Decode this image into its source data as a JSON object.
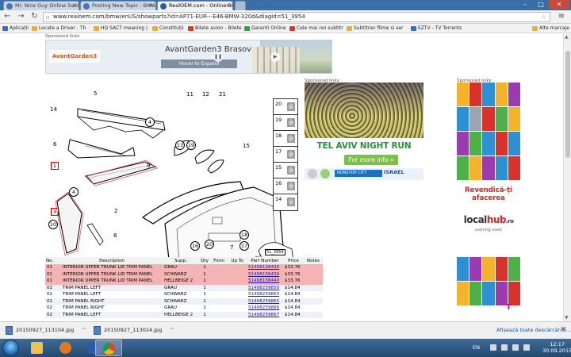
{
  "browser": {
    "tabs": [
      {
        "title": "Mr. Nice Guy Online Subtit"
      },
      {
        "title": "Posting New Topic - BMW"
      },
      {
        "title": "RealOEM.com - Online BM"
      }
    ],
    "address": "www.realoem.com/bmw/enUS/showparts?id=AP71-EUR---E46-BMW-320d&diagId=51_3954",
    "bookmarks": [
      "Aplicații",
      "Locate a Driver - Th",
      "HQ SACT meaning |",
      "Constituții",
      "Bilete avion - Bilete",
      "Garanti Online",
      "Cele mai noi subtitr",
      "Subtitran filme si ser",
      "EZTV - TV Torrents",
      "Alte marcaje"
    ]
  },
  "ads": {
    "sponsored_label": "Sponsored links",
    "top": {
      "logo": "AvantGarden3",
      "title": "AvantGarden3 Brasov",
      "hover": "Hover to Expand",
      "prev_icon": "pause-icon",
      "next_icon": "play-icon"
    },
    "middle": {
      "headline": "TEL AVIV NIGHT RUN",
      "button": "For more info »",
      "nonstop": "NONSTOP CITY",
      "israel": "ISRAEL"
    },
    "right": {
      "cta": "Revendică-ți afacerea",
      "brand_prefix": "local",
      "brand_suffix": "hub",
      "brand_tld": ".ro",
      "coming": "coming soon",
      "telekom": "T"
    }
  },
  "diagram": {
    "id": "51_3954",
    "numbers": [
      "5",
      "14",
      "6",
      "4",
      "1",
      "3",
      "10",
      "4",
      "2",
      "8",
      "11",
      "12",
      "13",
      "19",
      "21",
      "9",
      "15",
      "16",
      "20",
      "7",
      "18",
      "17"
    ],
    "small_parts": [
      "20",
      "19",
      "18",
      "17",
      "15",
      "16",
      "14"
    ]
  },
  "parts_table": {
    "headers": [
      "No.",
      "Description",
      "Supp.",
      "Qty",
      "From",
      "Up To",
      "Part Number",
      "Price",
      "Notes"
    ],
    "rows": [
      {
        "no": "01",
        "desc": "INTERIOR UPPER TRUNK LID TRIM PANEL",
        "supp": "GRAU",
        "qty": "1",
        "pn": "51498158436",
        "price": "$33.76",
        "style": "hl"
      },
      {
        "no": "01",
        "desc": "INTERIOR UPPER TRUNK LID TRIM PANEL",
        "supp": "SCHWARZ",
        "qty": "1",
        "pn": "51498158439",
        "price": "$33.76",
        "style": "hl"
      },
      {
        "no": "01",
        "desc": "INTERIOR UPPER TRUNK LID TRIM PANEL",
        "supp": "HELLBEIGE 2",
        "qty": "1",
        "pn": "51498158440",
        "price": "$33.76",
        "style": "hl"
      },
      {
        "no": "02",
        "desc": "TRIM PANEL LEFT",
        "supp": "GRAU",
        "qty": "1",
        "pn": "51498259859",
        "price": "$14.84",
        "style": "alt"
      },
      {
        "no": "02",
        "desc": "TRIM PANEL LEFT",
        "supp": "SCHWARZ",
        "qty": "1",
        "pn": "51498259860",
        "price": "$14.84",
        "style": ""
      },
      {
        "no": "02",
        "desc": "TRIM PANEL RIGHT",
        "supp": "SCHWARZ",
        "qty": "1",
        "pn": "51498259865",
        "price": "$14.84",
        "style": "alt"
      },
      {
        "no": "02",
        "desc": "TRIM PANEL RIGHT",
        "supp": "GRAU",
        "qty": "1",
        "pn": "51498259866",
        "price": "$14.84",
        "style": ""
      },
      {
        "no": "02",
        "desc": "TRIM PANEL LEFT",
        "supp": "HELLBEIGE 2",
        "qty": "1",
        "pn": "51498259867",
        "price": "$14.84",
        "style": "alt"
      }
    ]
  },
  "downloads": {
    "items": [
      "20150927_113104.jpg",
      "20150927_113024.jpg"
    ],
    "show_all": "Afișează toate descărcările..."
  },
  "taskbar": {
    "lang": "EN",
    "time": "12:17",
    "date": "30.09.2015"
  }
}
